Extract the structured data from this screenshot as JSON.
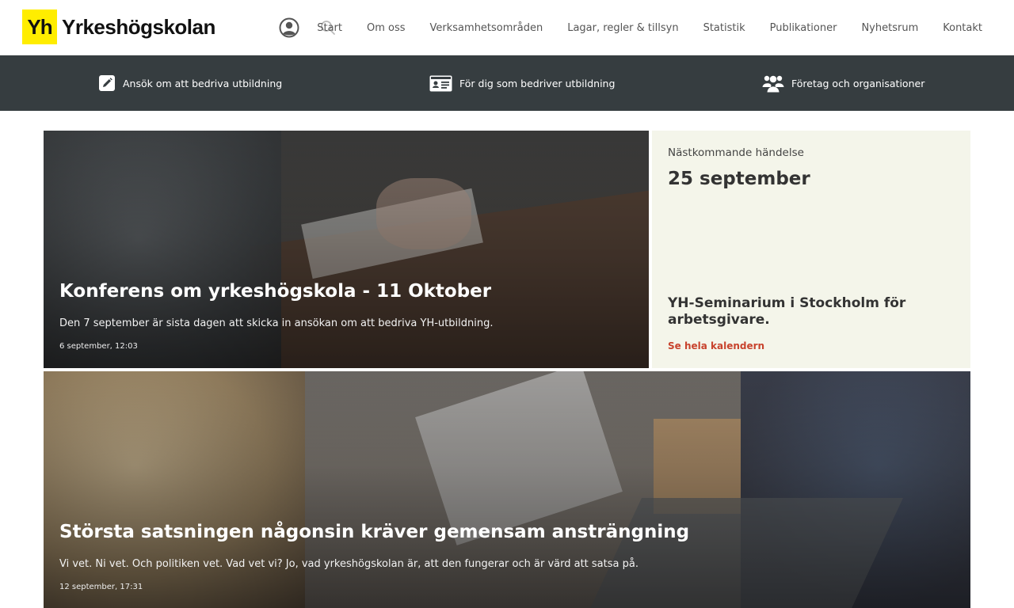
{
  "brand": {
    "logo_mark": "Yh",
    "logo_text": "Yrkeshögskolan"
  },
  "header": {
    "icons": {
      "user": "user-circle-icon",
      "search": "search-icon"
    },
    "nav": [
      "Start",
      "Om oss",
      "Verksamhetsområden",
      "Lagar, regler & tillsyn",
      "Statistik",
      "Publikationer",
      "Nyhetsrum",
      "Kontakt"
    ]
  },
  "subbar": {
    "items": [
      {
        "label": "Ansök om att bedriva utbildning",
        "icon": "pencil-icon"
      },
      {
        "label": "För dig som bedriver utbildning",
        "icon": "id-card-icon"
      },
      {
        "label": "Företag och organisationer",
        "icon": "users-icon"
      }
    ]
  },
  "featured": {
    "title": "Konferens om yrkeshögskola - 11 Oktober",
    "excerpt": "Den 7 september är sista dagen att skicka in ansökan om att bedriva YH-utbildning.",
    "date": "6 september, 12:03"
  },
  "event": {
    "label": "Nästkommande händelse",
    "date": "25 september",
    "title": "YH-Seminarium i Stockholm för arbetsgivare.",
    "link": "Se hela kalendern"
  },
  "second": {
    "title": "Största satsningen någonsin kräver gemensam ansträngning",
    "excerpt": "Vi vet. Ni vet. Och politiken vet. Vad vet vi? Jo, vad yrkeshögskolan är, att den fungerar och är värd att satsa på.",
    "date": "12 september, 17:31"
  },
  "colors": {
    "brand_yellow": "#ffed00",
    "subbar_bg": "#363d40",
    "event_bg": "#f4f5ea",
    "link_red": "#c8432d"
  }
}
